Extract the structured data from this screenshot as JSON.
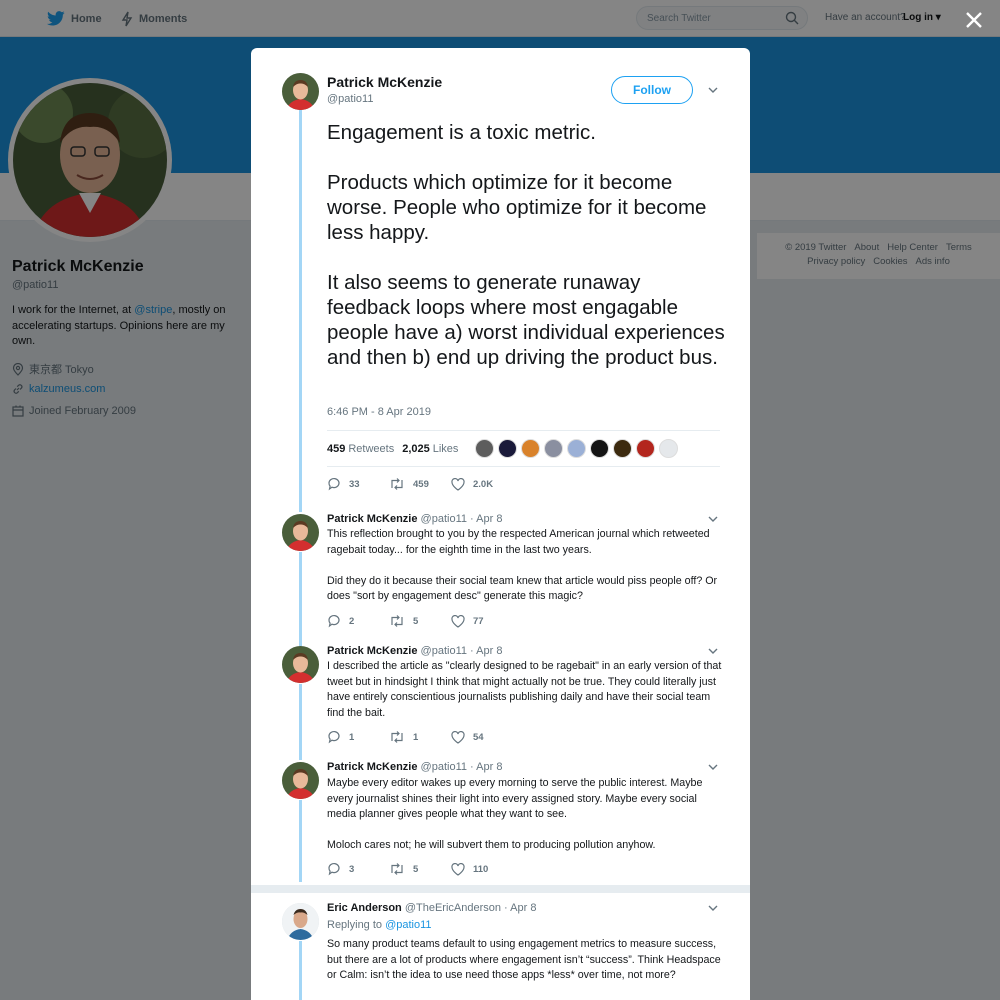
{
  "nav": {
    "home": "Home",
    "moments": "Moments",
    "search_placeholder": "Search Twitter",
    "have_account": "Have an account?",
    "login": "Log in"
  },
  "profile": {
    "name": "Patrick McKenzie",
    "handle": "@patio11",
    "bio_1": "I work for the Internet, at ",
    "bio_link": "@stripe",
    "bio_2": ", mostly on accelerating startups. Opinions here are my own.",
    "location": "東京都 Tokyo",
    "website": "kalzumeus.com",
    "joined": "Joined February 2009"
  },
  "footer": {
    "copyright": "© 2019 Twitter",
    "about": "About",
    "help": "Help Center",
    "terms": "Terms",
    "privacy": "Privacy policy",
    "cookies": "Cookies",
    "ads": "Ads info"
  },
  "tweet": {
    "name": "Patrick McKenzie",
    "handle": "@patio11",
    "follow": "Follow",
    "text": "Engagement is a toxic metric.\n\nProducts which optimize for it become worse. People who optimize for it become less happy.\n\nIt also seems to generate runaway feedback loops where most engagable people have a) worst individual experiences and then b) end up driving the product bus.",
    "time": "6:46 PM - 8 Apr 2019",
    "retweets_count": "459",
    "retweets_label": "Retweets",
    "likes_count": "2,025",
    "likes_label": "Likes",
    "actions": {
      "replies": "33",
      "retweets": "459",
      "likes": "2.0K"
    }
  },
  "replies": [
    {
      "name": "Patrick McKenzie",
      "meta": "@patio11 · Apr 8",
      "text": "This reflection brought to you by the respected American journal which retweeted ragebait today... for the eighth time in the last two years.\n\nDid they do it because their social team knew that article would piss people off? Or does \"sort by engagement desc\"  generate this magic?",
      "replies": "2",
      "retweets": "5",
      "likes": "77"
    },
    {
      "name": "Patrick McKenzie",
      "meta": "@patio11 · Apr 8",
      "text": "I described the article as \"clearly designed to be ragebait\" in an early version of that tweet but in hindsight I think that might actually not be true. They could literally just have entirely conscientious journalists publishing daily and have their social team find the bait.",
      "replies": "1",
      "retweets": "1",
      "likes": "54"
    },
    {
      "name": "Patrick McKenzie",
      "meta": "@patio11 · Apr 8",
      "text": "Maybe every editor wakes up every morning to serve the public interest. Maybe every journalist shines their light into every assigned story. Maybe every social media planner gives people what they want to see.\n\nMoloch cares not; he will subvert them to producing pollution anyhow.",
      "replies": "3",
      "retweets": "5",
      "likes": "110"
    }
  ],
  "other_reply": {
    "name": "Eric Anderson",
    "meta": "@TheEricAnderson · Apr 8",
    "replying_to": "Replying to ",
    "replying_handle": "@patio11",
    "text": "So many product teams default to using engagement metrics to measure success, but there are a lot of products where engagement isn’t “success”. Think Headspace or Calm: isn’t the idea to use need those apps *less* over time, not more?"
  },
  "colors": {
    "accent": "#1da1f2",
    "banner": "#1b95e0",
    "thread_line": "#a3d6f6"
  }
}
